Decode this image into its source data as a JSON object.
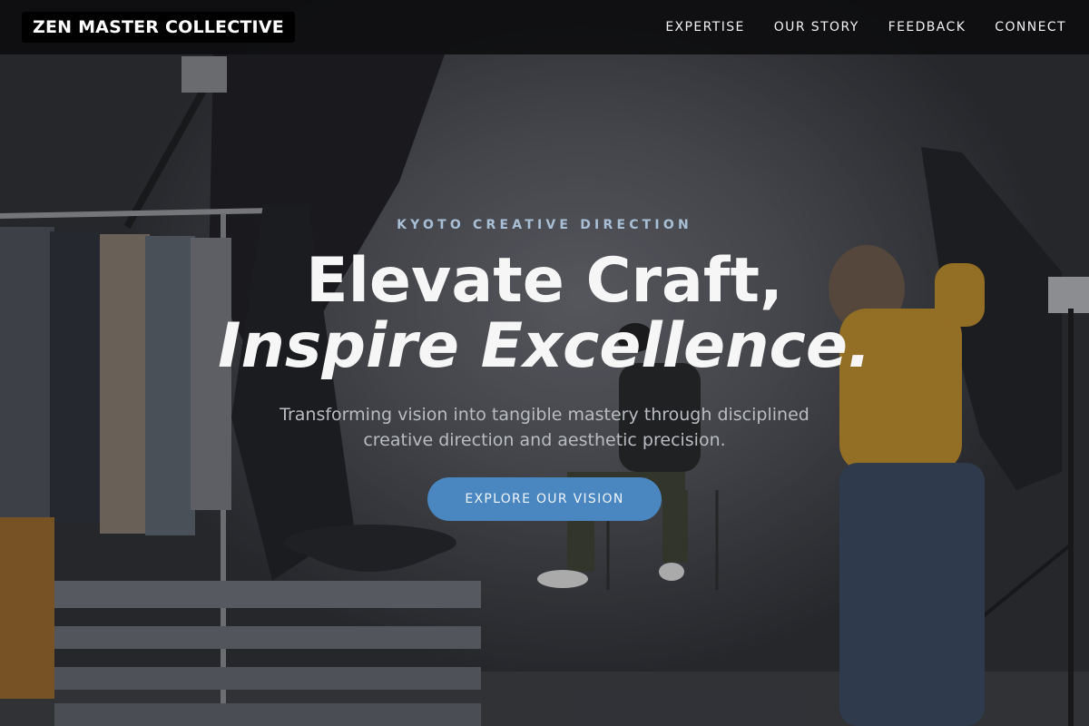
{
  "brand": {
    "name": "ZEN MASTER COLLECTIVE"
  },
  "nav": {
    "items": [
      {
        "label": "EXPERTISE"
      },
      {
        "label": "OUR STORY"
      },
      {
        "label": "FEEDBACK"
      },
      {
        "label": "CONNECT"
      }
    ]
  },
  "hero": {
    "eyebrow": "KYOTO CREATIVE DIRECTION",
    "headline_line1": "Elevate Craft,",
    "headline_line2": "Inspire Excellence.",
    "subtitle": "Transforming vision into tangible mastery through disciplined creative direction and aesthetic precision.",
    "cta_label": "EXPLORE OUR VISION",
    "background_image_subject": "photo-studio-shoot"
  },
  "colors": {
    "nav_background": "#0e0e10",
    "eyebrow": "#a9bfd6",
    "cta_background": "#4a87c0",
    "subtitle": "#b9bcc1"
  }
}
